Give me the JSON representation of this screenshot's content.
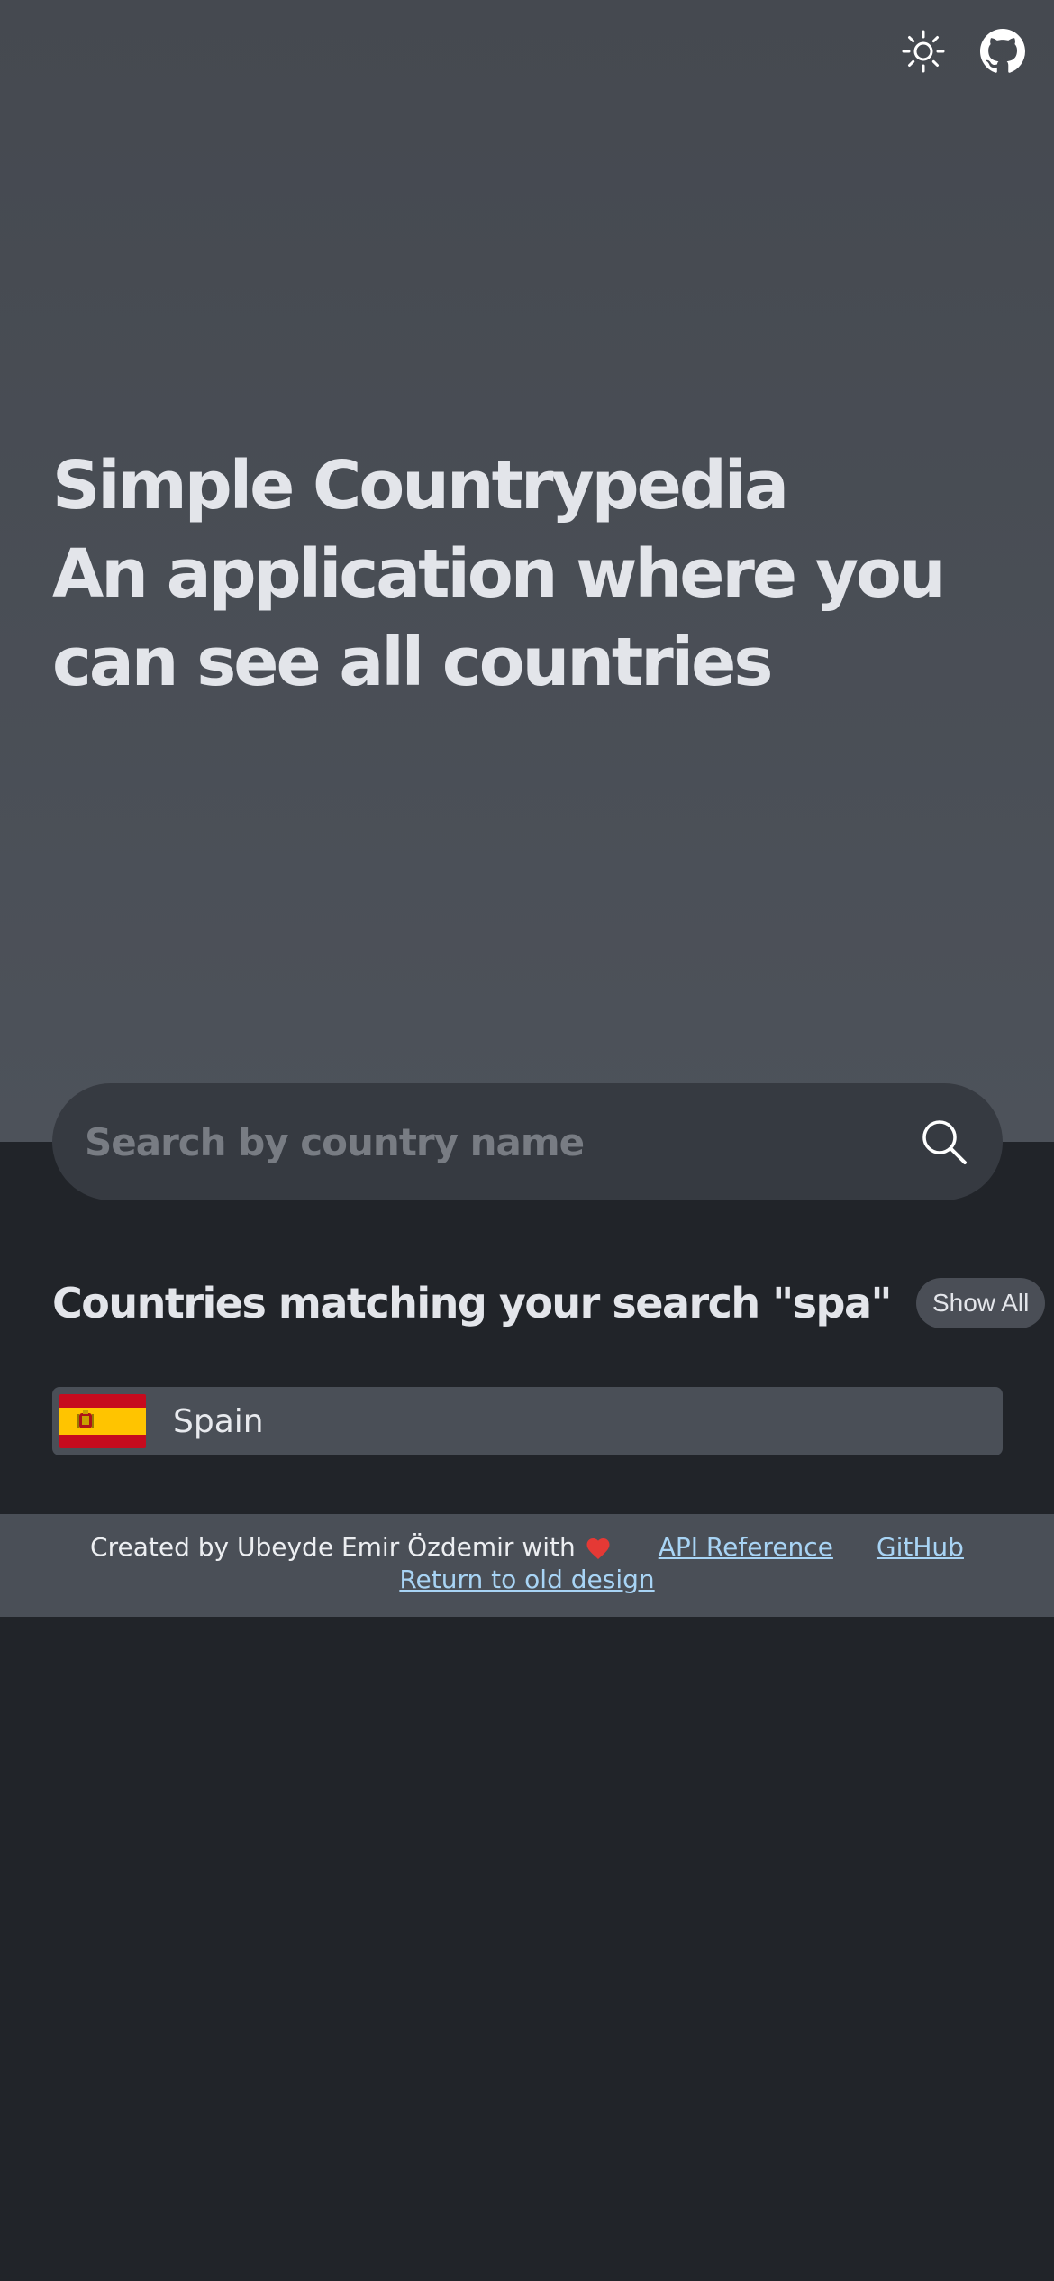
{
  "header": {
    "theme_toggle_icon": "sun-icon",
    "github_icon": "github-icon"
  },
  "hero": {
    "title": "Simple Countrypedia",
    "subtitle": "An application where you can see all countries"
  },
  "search": {
    "placeholder": "Search by country name",
    "value": "",
    "button_icon": "search-icon"
  },
  "results": {
    "title": "Countries matching your search \"spa\"",
    "show_all_label": "Show All",
    "items": [
      {
        "name": "Spain",
        "flag": "spain-flag"
      }
    ]
  },
  "footer": {
    "created_by": "Created by Ubeyde Emir Özdemir with",
    "heart_icon": "heart-icon",
    "api_reference_label": "API Reference",
    "github_label": "GitHub",
    "old_design_label": "Return to old design"
  },
  "colors": {
    "hero_bg": "#4a4e56",
    "page_bg": "#212429",
    "search_bg": "#363a41",
    "link": "#a8d4f5",
    "heart": "#e53935"
  }
}
